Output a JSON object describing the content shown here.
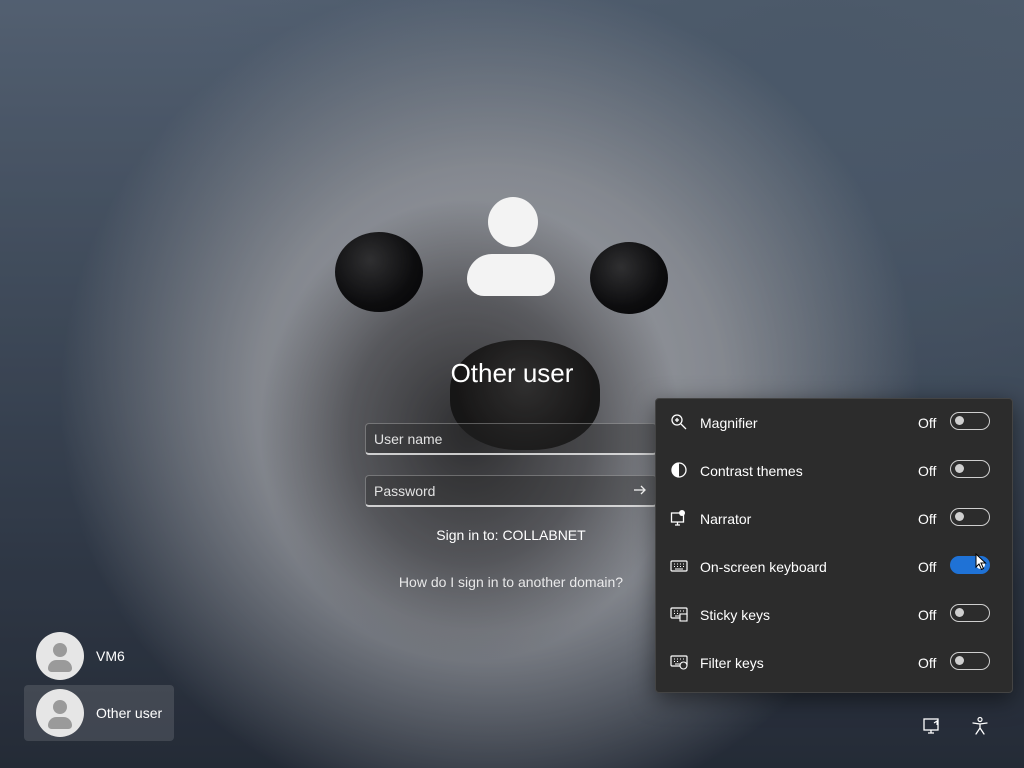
{
  "login": {
    "title": "Other user",
    "username_placeholder": "User name",
    "password_placeholder": "Password",
    "sign_in_to": "Sign in to: COLLABNET",
    "other_domain_link": "How do I sign in to another domain?"
  },
  "users": [
    {
      "name": "VM6",
      "selected": false
    },
    {
      "name": "Other user",
      "selected": true
    }
  ],
  "accessibility": {
    "items": [
      {
        "label": "Magnifier",
        "state": "Off",
        "icon": "magnifier-icon",
        "on": false
      },
      {
        "label": "Contrast themes",
        "state": "Off",
        "icon": "contrast-icon",
        "on": false
      },
      {
        "label": "Narrator",
        "state": "Off",
        "icon": "narrator-icon",
        "on": false
      },
      {
        "label": "On-screen keyboard",
        "state": "Off",
        "icon": "keyboard-icon",
        "on": true
      },
      {
        "label": "Sticky keys",
        "state": "Off",
        "icon": "sticky-keys-icon",
        "on": false
      },
      {
        "label": "Filter keys",
        "state": "Off",
        "icon": "filter-keys-icon",
        "on": false
      }
    ]
  },
  "corner_buttons": [
    {
      "icon": "network-icon"
    },
    {
      "icon": "accessibility-icon"
    }
  ]
}
